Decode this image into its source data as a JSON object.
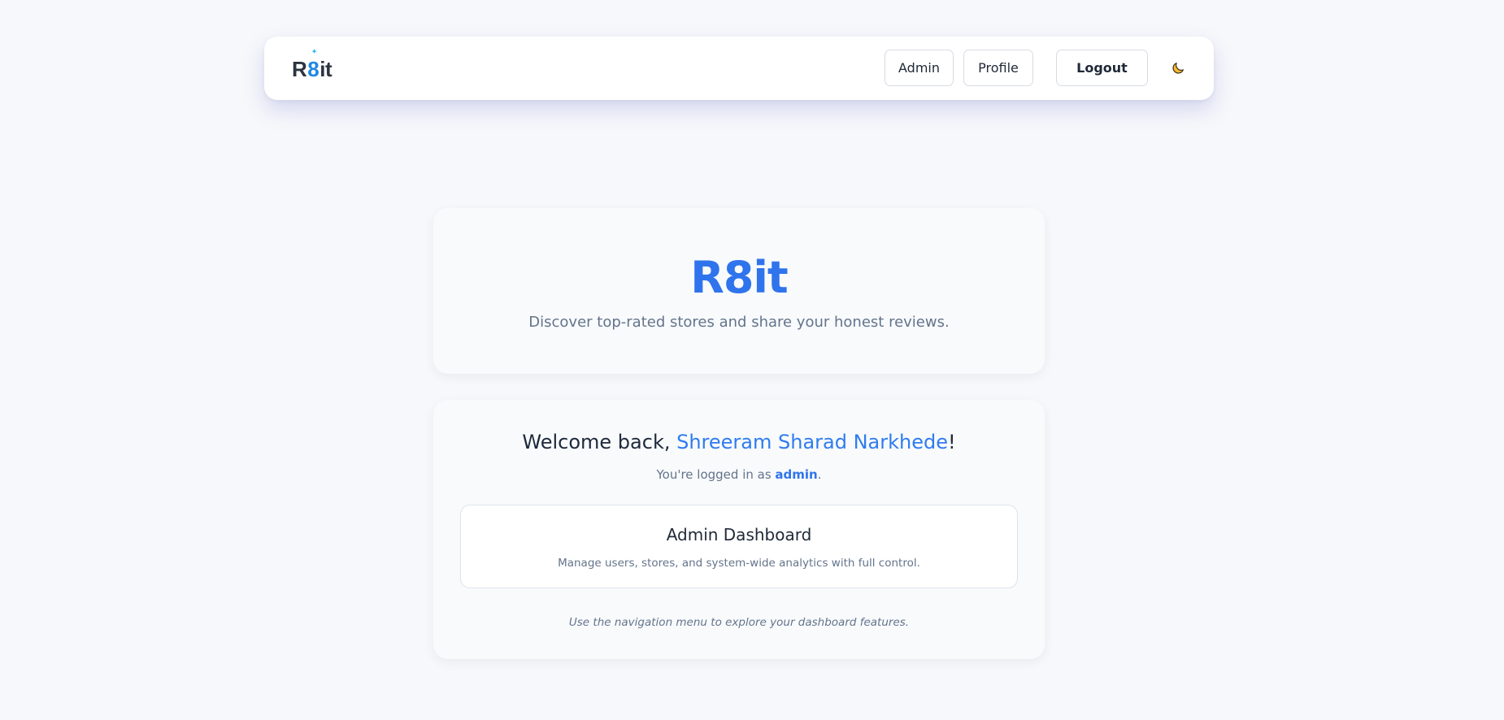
{
  "navbar": {
    "logo": {
      "prefix": "R",
      "eight": "8",
      "suffix": "it"
    },
    "admin_label": "Admin",
    "profile_label": "Profile",
    "logout_label": "Logout",
    "theme_icon": "moon-icon"
  },
  "hero": {
    "title": "R8it",
    "subtitle": "Discover top-rated stores and share your honest reviews."
  },
  "welcome": {
    "prefix": "Welcome back, ",
    "user_name": "Shreeram Sharad Narkhede",
    "suffix": "!",
    "logged_prefix": "You're logged in as ",
    "role": "admin",
    "logged_suffix": "."
  },
  "dashboard_card": {
    "title": "Admin Dashboard",
    "description": "Manage users, stores, and system-wide analytics with full control."
  },
  "hint": "Use the navigation menu to explore your dashboard features.",
  "colors": {
    "accent": "#2f74ec",
    "background": "#f7f8fb",
    "moon": "#f5b82e"
  }
}
